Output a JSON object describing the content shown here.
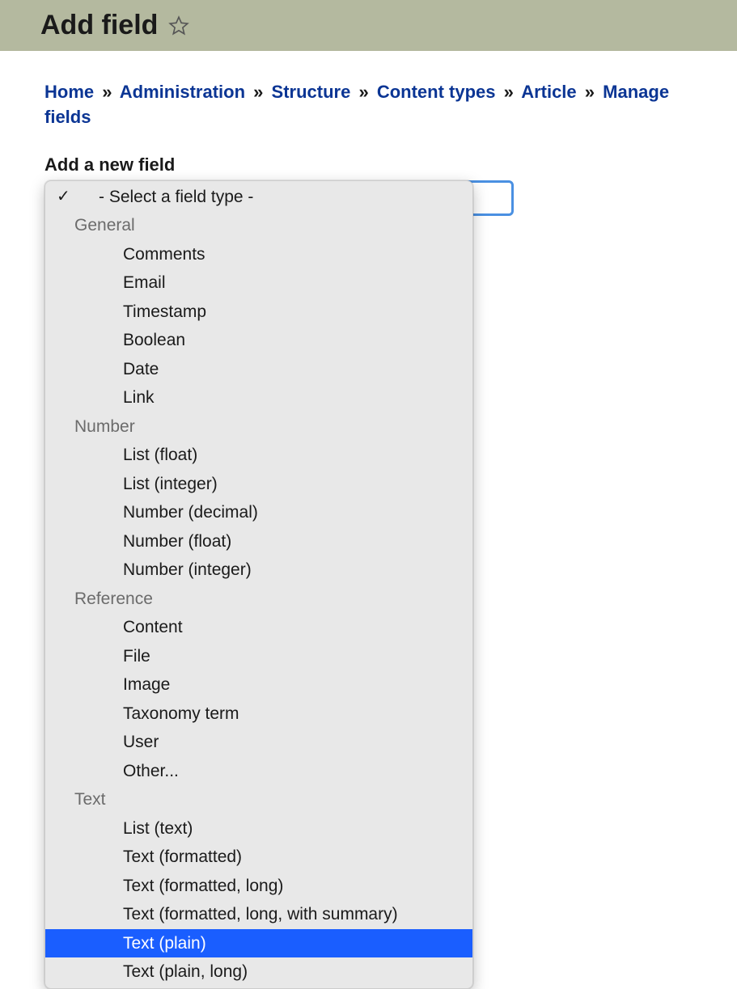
{
  "header": {
    "title": "Add field"
  },
  "breadcrumb": {
    "items": [
      "Home",
      "Administration",
      "Structure",
      "Content types",
      "Article",
      "Manage fields"
    ],
    "separator": "»"
  },
  "section": {
    "heading": "Add a new field"
  },
  "dropdown": {
    "placeholder": "- Select a field type -",
    "groups": [
      {
        "label": "General",
        "options": [
          "Comments",
          "Email",
          "Timestamp",
          "Boolean",
          "Date",
          "Link"
        ]
      },
      {
        "label": "Number",
        "options": [
          "List (float)",
          "List (integer)",
          "Number (decimal)",
          "Number (float)",
          "Number (integer)"
        ]
      },
      {
        "label": "Reference",
        "options": [
          "Content",
          "File",
          "Image",
          "Taxonomy term",
          "User",
          "Other..."
        ]
      },
      {
        "label": "Text",
        "options": [
          "List (text)",
          "Text (formatted)",
          "Text (formatted, long)",
          "Text (formatted, long, with summary)",
          "Text (plain)",
          "Text (plain, long)"
        ]
      }
    ],
    "selected": "Text (plain)"
  }
}
